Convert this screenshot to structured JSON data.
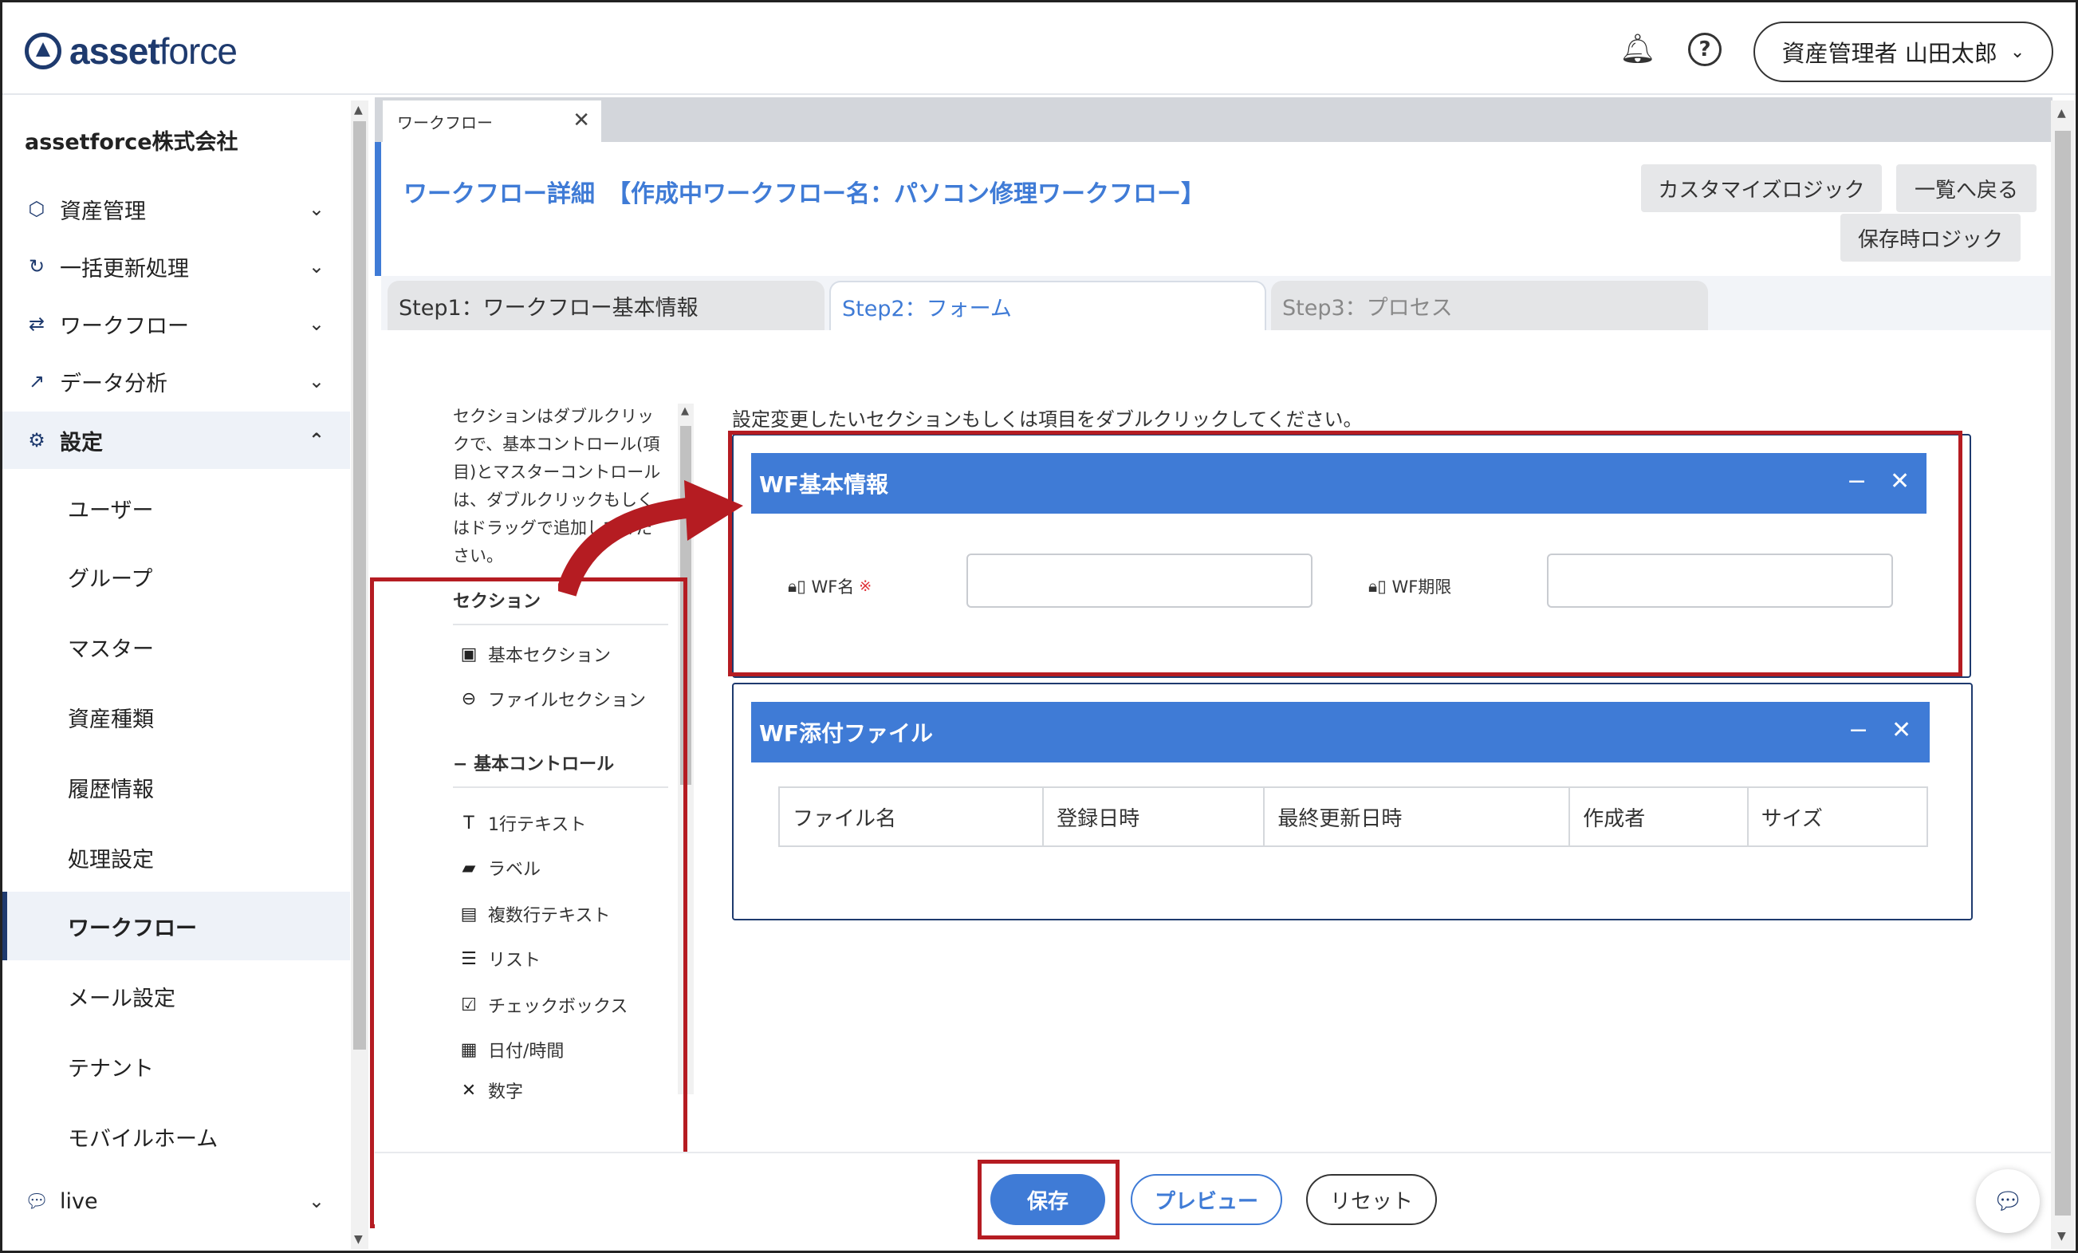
{
  "header": {
    "logo_bold": "asset",
    "logo_light": "force",
    "user_name": "資産管理者 山田太郎",
    "help_glyph": "?"
  },
  "sidebar": {
    "company": "assetforce株式会社",
    "groups": [
      {
        "label": "資産管理",
        "icon": "cube-icon"
      },
      {
        "label": "一括更新処理",
        "icon": "refresh-icon"
      },
      {
        "label": "ワークフロー",
        "icon": "workflow-icon"
      },
      {
        "label": "データ分析",
        "icon": "analytics-icon"
      },
      {
        "label": "設定",
        "icon": "gear-icon"
      },
      {
        "label": "live",
        "icon": "chat-icon"
      }
    ],
    "settings_items": [
      "ユーザー",
      "グループ",
      "マスター",
      "資産種類",
      "履歴情報",
      "処理設定",
      "ワークフロー",
      "メール設定",
      "テナント",
      "モバイルホーム"
    ],
    "active_item": "ワークフロー"
  },
  "window_tab": {
    "label": "ワークフロー"
  },
  "page": {
    "title": "ワークフロー詳細　【作成中ワークフロー名：パソコン修理ワークフロー】",
    "customize_logic": "カスタマイズロジック",
    "back_to_list": "一覧へ戻る",
    "save_logic": "保存時ロジック"
  },
  "steps": {
    "step1": "Step1：ワークフロー基本情報",
    "step2": "Step2：フォーム",
    "step3": "Step3：プロセス",
    "active": "step2"
  },
  "palette": {
    "instruction": "セクションはダブルクリックで、基本コントロール(項目)とマスターコントロールは、ダブルクリックもしくはドラッグで追加してください。",
    "section_heading": "セクション",
    "sections": [
      {
        "label": "基本セクション",
        "icon": "id-card-icon"
      },
      {
        "label": "ファイルセクション",
        "icon": "paperclip-icon"
      }
    ],
    "controls_heading": "基本コントロール",
    "controls": [
      {
        "label": "1行テキスト",
        "icon": "text-icon"
      },
      {
        "label": "ラベル",
        "icon": "label-icon"
      },
      {
        "label": "複数行テキスト",
        "icon": "multiline-icon"
      },
      {
        "label": "リスト",
        "icon": "list-icon"
      },
      {
        "label": "チェックボックス",
        "icon": "checkbox-icon"
      },
      {
        "label": "日付/時間",
        "icon": "calendar-icon"
      },
      {
        "label": "数字",
        "icon": "number-icon"
      }
    ]
  },
  "canvas": {
    "instruction": "設定変更したいセクションもしくは項目をダブルクリックしてください。",
    "section1": {
      "title": "WF基本情報",
      "fields": [
        {
          "label": "WF名",
          "required_mark": "※",
          "value": ""
        },
        {
          "label": "WF期限",
          "value": ""
        }
      ]
    },
    "section2": {
      "title": "WF添付ファイル",
      "columns": [
        "ファイル名",
        "登録日時",
        "最終更新日時",
        "作成者",
        "サイズ"
      ]
    }
  },
  "actions": {
    "save": "保存",
    "preview": "プレビュー",
    "reset": "リセット"
  },
  "colors": {
    "brand": "#1e3a6e",
    "accent": "#3f7bd6",
    "highlight": "#b51c22"
  }
}
